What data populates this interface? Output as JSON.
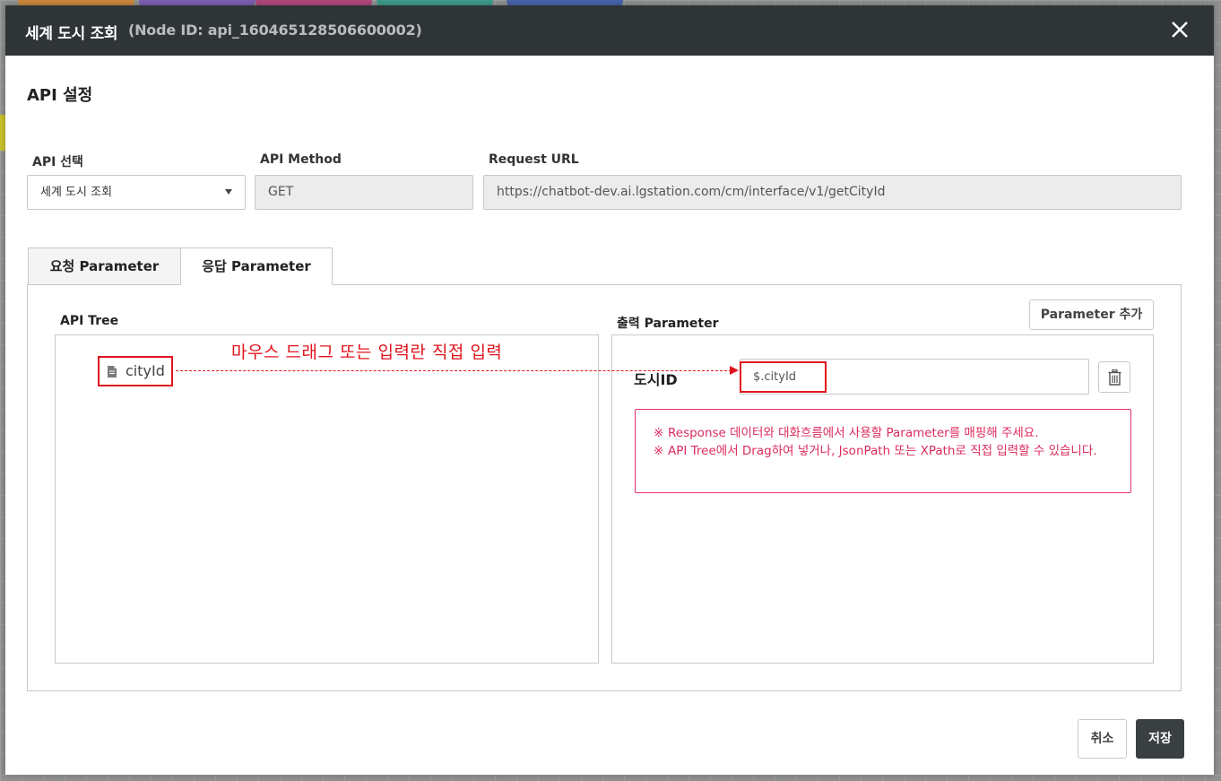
{
  "modal": {
    "title": "세계 도시 조회",
    "subtitle": "(Node ID: api_160465128506600002)"
  },
  "section_title": "API 설정",
  "fields": {
    "api_select_label": "API 선택",
    "api_select_value": "세계 도시 조회",
    "api_method_label": "API Method",
    "api_method_value": "GET",
    "request_url_label": "Request URL",
    "request_url_value": "https://chatbot-dev.ai.lgstation.com/cm/interface/v1/getCityId"
  },
  "tabs": [
    {
      "label": "요청 Parameter",
      "active": false
    },
    {
      "label": "응답 Parameter",
      "active": true
    }
  ],
  "api_tree": {
    "label": "API Tree",
    "nodes": [
      {
        "label": "cityId",
        "icon": "file-icon"
      }
    ]
  },
  "annotation": {
    "hint": "마우스 드래그 또는 입력란 직접 입력",
    "color": "#e0141e"
  },
  "output": {
    "label": "출력 Parameter",
    "add_button": "Parameter 추가",
    "params": [
      {
        "name": "도시ID",
        "value": "$.cityId"
      }
    ]
  },
  "notice": {
    "mark": "※",
    "line1": "Response 데이터와 대화흐름에서 사용할 Parameter를 매핑해 주세요.",
    "line2": "API Tree에서 Drag하여 넣거나, JsonPath 또는 XPath로 직접 입력할 수 있습니다."
  },
  "footer": {
    "cancel": "취소",
    "save": "저장"
  },
  "colors": {
    "header_bg": "#2f3437",
    "notice": "#dc2a5c",
    "primary_button": "#3a3f42"
  }
}
